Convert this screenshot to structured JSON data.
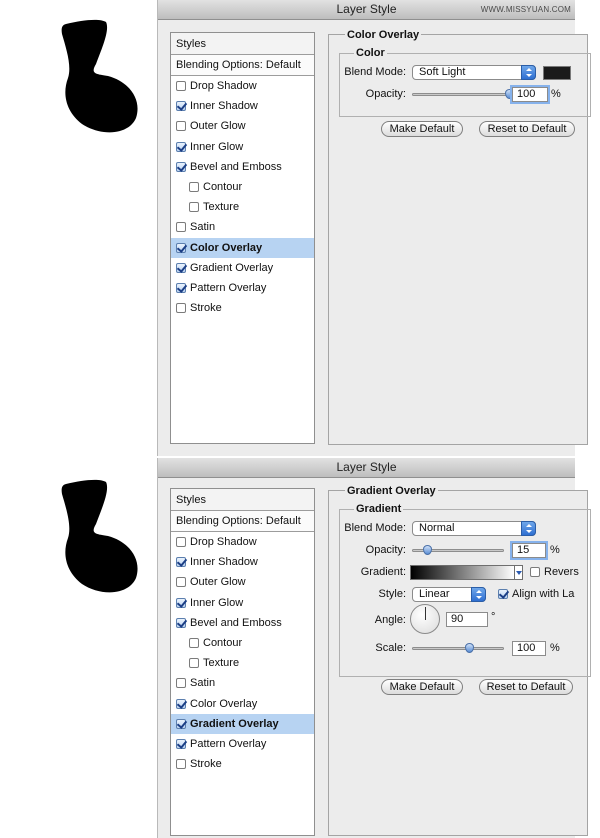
{
  "watermark": "WWW.MISSYUAN.COM",
  "colors": {
    "shape": "#000000",
    "selection": "#b7d3f2",
    "accent": "#3a7de0",
    "swatch": "#1b1b1b"
  },
  "icons": {
    "shape": "black-blob-icon",
    "checkbox": "checkbox-checked-icon",
    "combo": "dropdown-arrows-icon"
  },
  "dialog1": {
    "title": "Layer Style",
    "styles_header": "Styles",
    "blending_options": "Blending Options: Default",
    "items": [
      {
        "label": "Drop Shadow",
        "checked": false,
        "sub": false,
        "selected": false
      },
      {
        "label": "Inner Shadow",
        "checked": true,
        "sub": false,
        "selected": false
      },
      {
        "label": "Outer Glow",
        "checked": false,
        "sub": false,
        "selected": false
      },
      {
        "label": "Inner Glow",
        "checked": true,
        "sub": false,
        "selected": false
      },
      {
        "label": "Bevel and Emboss",
        "checked": true,
        "sub": false,
        "selected": false
      },
      {
        "label": "Contour",
        "checked": false,
        "sub": true,
        "selected": false
      },
      {
        "label": "Texture",
        "checked": false,
        "sub": true,
        "selected": false
      },
      {
        "label": "Satin",
        "checked": false,
        "sub": false,
        "selected": false
      },
      {
        "label": "Color Overlay",
        "checked": true,
        "sub": false,
        "selected": true
      },
      {
        "label": "Gradient Overlay",
        "checked": true,
        "sub": false,
        "selected": false
      },
      {
        "label": "Pattern Overlay",
        "checked": true,
        "sub": false,
        "selected": false
      },
      {
        "label": "Stroke",
        "checked": false,
        "sub": false,
        "selected": false
      }
    ],
    "panel_title": "Color Overlay",
    "group_title": "Color",
    "blend_mode_label": "Blend Mode:",
    "blend_mode_value": "Soft Light",
    "opacity_label": "Opacity:",
    "opacity_value": "100",
    "opacity_unit": "%",
    "opacity_fraction": 1.0,
    "make_default": "Make Default",
    "reset_default": "Reset to Default"
  },
  "dialog2": {
    "title": "Layer Style",
    "styles_header": "Styles",
    "blending_options": "Blending Options: Default",
    "items": [
      {
        "label": "Drop Shadow",
        "checked": false,
        "sub": false,
        "selected": false
      },
      {
        "label": "Inner Shadow",
        "checked": true,
        "sub": false,
        "selected": false
      },
      {
        "label": "Outer Glow",
        "checked": false,
        "sub": false,
        "selected": false
      },
      {
        "label": "Inner Glow",
        "checked": true,
        "sub": false,
        "selected": false
      },
      {
        "label": "Bevel and Emboss",
        "checked": true,
        "sub": false,
        "selected": false
      },
      {
        "label": "Contour",
        "checked": false,
        "sub": true,
        "selected": false
      },
      {
        "label": "Texture",
        "checked": false,
        "sub": true,
        "selected": false
      },
      {
        "label": "Satin",
        "checked": false,
        "sub": false,
        "selected": false
      },
      {
        "label": "Color Overlay",
        "checked": true,
        "sub": false,
        "selected": false
      },
      {
        "label": "Gradient Overlay",
        "checked": true,
        "sub": false,
        "selected": true
      },
      {
        "label": "Pattern Overlay",
        "checked": true,
        "sub": false,
        "selected": false
      },
      {
        "label": "Stroke",
        "checked": false,
        "sub": false,
        "selected": false
      }
    ],
    "panel_title": "Gradient Overlay",
    "group_title": "Gradient",
    "blend_mode_label": "Blend Mode:",
    "blend_mode_value": "Normal",
    "opacity_label": "Opacity:",
    "opacity_value": "15",
    "opacity_unit": "%",
    "opacity_fraction": 0.15,
    "gradient_label": "Gradient:",
    "reverse_label": "Revers",
    "reverse_checked": false,
    "style_label": "Style:",
    "style_value": "Linear",
    "align_label": "Align with La",
    "align_checked": true,
    "angle_label": "Angle:",
    "angle_value": "90",
    "angle_unit": "°",
    "scale_label": "Scale:",
    "scale_value": "100",
    "scale_unit": "%",
    "scale_fraction": 0.62,
    "make_default": "Make Default",
    "reset_default": "Reset to Default"
  }
}
